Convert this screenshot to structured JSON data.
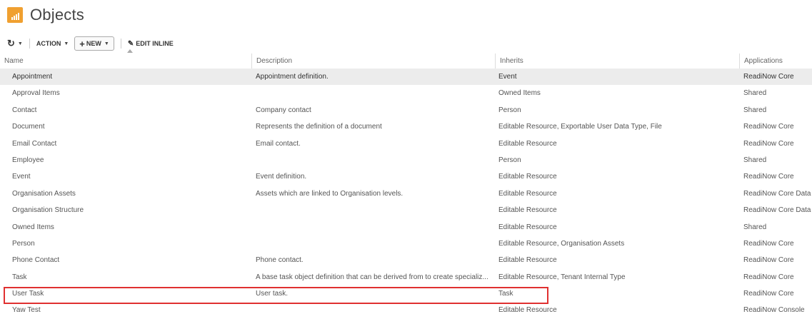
{
  "page": {
    "title": "Objects",
    "icon": "chart-bars-icon",
    "accent_color": "#f0a030"
  },
  "toolbar": {
    "refresh_icon": "refresh-icon",
    "action_label": "ACTION",
    "new_label": "NEW",
    "edit_inline_label": "EDIT INLINE"
  },
  "columns": {
    "name": "Name",
    "description": "Description",
    "inherits": "Inherits",
    "applications": "Applications"
  },
  "rows": [
    {
      "name": "Appointment",
      "description": "Appointment definition.",
      "inherits": "Event",
      "applications": "ReadiNow Core"
    },
    {
      "name": "Approval Items",
      "description": "",
      "inherits": "Owned Items",
      "applications": "Shared"
    },
    {
      "name": "Contact",
      "description": "Company contact",
      "inherits": "Person",
      "applications": "Shared"
    },
    {
      "name": "Document",
      "description": "Represents the definition of a document",
      "inherits": "Editable Resource, Exportable User Data Type, File",
      "applications": "ReadiNow Core"
    },
    {
      "name": "Email Contact",
      "description": "Email contact.",
      "inherits": "Editable Resource",
      "applications": "ReadiNow Core"
    },
    {
      "name": "Employee",
      "description": "",
      "inherits": "Person",
      "applications": "Shared"
    },
    {
      "name": "Event",
      "description": "Event definition.",
      "inherits": "Editable Resource",
      "applications": "ReadiNow Core"
    },
    {
      "name": "Organisation Assets",
      "description": "Assets which are linked to Organisation levels.",
      "inherits": "Editable Resource",
      "applications": "ReadiNow Core Data"
    },
    {
      "name": "Organisation Structure",
      "description": "",
      "inherits": "Editable Resource",
      "applications": "ReadiNow Core Data"
    },
    {
      "name": "Owned Items",
      "description": "",
      "inherits": "Editable Resource",
      "applications": "Shared"
    },
    {
      "name": "Person",
      "description": "",
      "inherits": "Editable Resource, Organisation Assets",
      "applications": "ReadiNow Core"
    },
    {
      "name": "Phone Contact",
      "description": "Phone contact.",
      "inherits": "Editable Resource",
      "applications": "ReadiNow Core"
    },
    {
      "name": "Task",
      "description": "A base task object definition that can be derived from to create specializ...",
      "inherits": "Editable Resource, Tenant Internal Type",
      "applications": "ReadiNow Core"
    },
    {
      "name": "User Task",
      "description": "User task.",
      "inherits": "Task",
      "applications": "ReadiNow Core"
    },
    {
      "name": "Yaw Test",
      "description": "",
      "inherits": "Editable Resource",
      "applications": "ReadiNow Console"
    }
  ],
  "selected_row_index": 0,
  "highlighted_row_index": 13,
  "highlight_color": "#e03030"
}
